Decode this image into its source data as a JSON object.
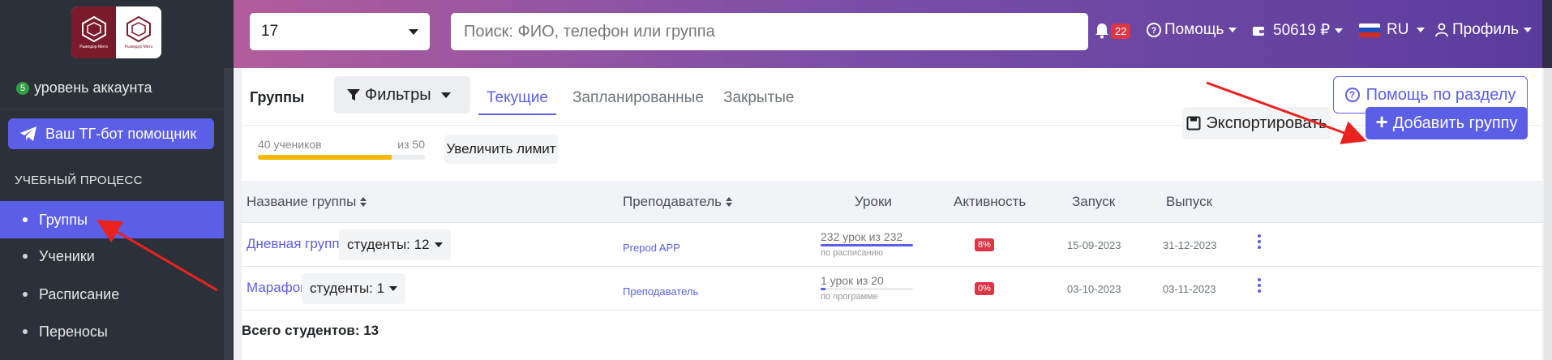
{
  "sidebar": {
    "logo": {
      "caption_left": "Рыжедор Митэ",
      "caption_right": "Рыжедор Митэ"
    },
    "account_level": {
      "badge": "5",
      "label": "уровень аккаунта"
    },
    "tg_button": "Ваш ТГ-бот помощник",
    "section_title": "УЧЕБНЫЙ ПРОЦЕСС",
    "items": [
      {
        "label": "Группы",
        "active": true
      },
      {
        "label": "Ученики"
      },
      {
        "label": "Расписание"
      },
      {
        "label": "Переносы"
      }
    ]
  },
  "header": {
    "number_select": "17",
    "search_placeholder": "Поиск: ФИО, телефон или группа",
    "notifications_count": "22",
    "help": "Помощь",
    "balance": "50619 ₽",
    "language": "RU",
    "profile": "Профиль"
  },
  "toolbar": {
    "title": "Группы",
    "filters": "Фильтры",
    "tabs": [
      "Текущие",
      "Запланированные",
      "Закрытые"
    ],
    "active_tab": 0,
    "help_section": "Помощь по разделу"
  },
  "limit": {
    "students_label": "40 учеников",
    "of_label": "из 50",
    "fill_percent": 80,
    "increase_button": "Увеличить лимит"
  },
  "actions": {
    "export": "Экспортировать",
    "add_group": "Добавить группу"
  },
  "table": {
    "columns": [
      "Название группы",
      "Преподаватель",
      "Уроки",
      "Активность",
      "Запуск",
      "Выпуск"
    ],
    "rows": [
      {
        "name": "Дневная группа",
        "students": "студенты: 12",
        "teacher": "Prepod APP",
        "lessons": "232 урок из 232",
        "lessons_note": "по расписанию",
        "lessons_progress": 100,
        "activity": "8%",
        "start": "15-09-2023",
        "end": "31-12-2023"
      },
      {
        "name": "Марафон",
        "students": "студенты: 1",
        "teacher": "Преподаватель",
        "lessons": "1 урок из 20",
        "lessons_note": "по программе",
        "lessons_progress": 5,
        "activity": "0%",
        "start": "03-10-2023",
        "end": "03-11-2023"
      }
    ],
    "total": "Всего студентов: 13"
  },
  "colors": {
    "accent": "#5b5fe8",
    "sidebar_bg": "#2c3139",
    "limit_fill": "#f5b800",
    "danger": "#dc3545",
    "annotation_arrow": "#e8231f"
  }
}
